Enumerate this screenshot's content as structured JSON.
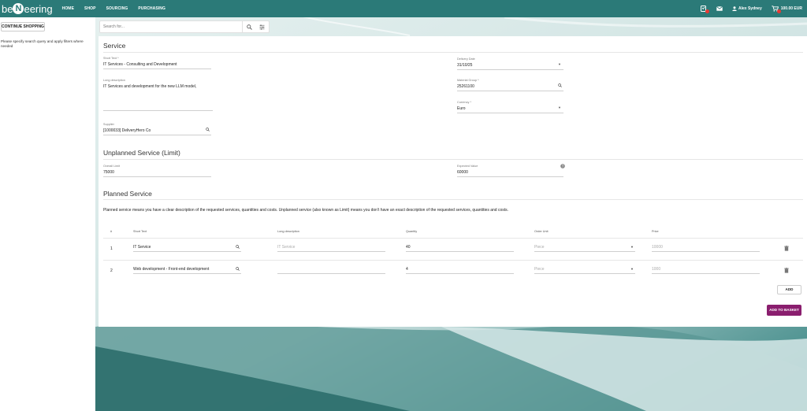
{
  "brand": {
    "logo_left": "be",
    "logo_mid": "N",
    "logo_right": "eering"
  },
  "nav": [
    "HOME",
    "SHOP",
    "SOURCING",
    "PURCHASING"
  ],
  "header": {
    "user": "Alex Sydney",
    "cart_total": "100.00 EUR"
  },
  "left": {
    "continue_label": "CONTINUE SHOPPING",
    "hint": "Please specify search query and apply filters where needed"
  },
  "search": {
    "placeholder": "Search for..."
  },
  "service": {
    "title": "Service",
    "short_text_label": "Short Text *",
    "short_text_value": "IT Services - Consulting and Development",
    "long_desc_label": "Long description",
    "long_desc_value": "IT Services and development for the new LLM model,",
    "supplier_label": "Supplier",
    "supplier_value": "[1000033] DeliveryHero Co",
    "delivery_label": "Delivery Date",
    "delivery_value": "31/10/25",
    "material_label": "Material Group *",
    "material_value": "25261100",
    "currency_label": "Currency *",
    "currency_value": "Euro"
  },
  "unplanned": {
    "title": "Unplanned Service (Limit)",
    "overall_label": "Overall Limit",
    "overall_value": "75000",
    "expected_label": "Expected Value",
    "expected_value": "60000"
  },
  "planned": {
    "title": "Planned Service",
    "description": "Planned service means you have a clear description of the requested services, quantities and costs. Unplanned service (also known as Limit) means you don't have an exact description of the requested services, quantities and costs.",
    "columns": [
      "#",
      "Short Text",
      "Long description",
      "Quantity",
      "Order Unit",
      "Price"
    ],
    "rows": [
      {
        "num": "1",
        "short": "IT Service",
        "long": "IT Service",
        "qty": "40",
        "unit": "Piece",
        "price": "10000"
      },
      {
        "num": "2",
        "short": "Web development - Front-end development",
        "long": "",
        "qty": "4",
        "unit": "Piece",
        "price": "1000"
      }
    ],
    "add_label": "ADD",
    "basket_label": "ADD TO BASKET"
  },
  "colors": {
    "topbar": "#2b7a78",
    "basket": "#8a1e6e",
    "badge": "#e53935"
  }
}
